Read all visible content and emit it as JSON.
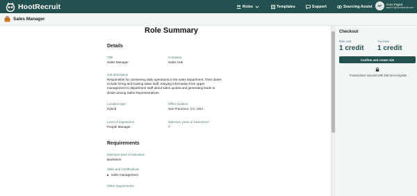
{
  "app": {
    "brand": "HootRecruit"
  },
  "nav": {
    "roles": "Roles",
    "templates": "Templates",
    "support": "Support",
    "sourcing": "Sourcing Assist"
  },
  "user": {
    "initials": "AP",
    "name": "Anne Paged",
    "email": "anne+1@hootrecruit.com"
  },
  "subheader": {
    "title": "Sales Manager"
  },
  "summary": {
    "heading": "Role Summary",
    "details": {
      "heading": "Details",
      "title_label": "Title",
      "title_value": "Sales Manager",
      "company_label": "Company",
      "company_value": "Sales Hub",
      "job_desc_label": "Job description",
      "job_desc_lines": [
        "Responsible for overseeing daily operations in the sales department. Their duties",
        "include hiring and training sales staff, relaying information from upper",
        "management to department staff about sales quotas and generating leads to",
        "divide among Sales Representatives."
      ],
      "location_type_label": "Location type",
      "location_type_value": "Hybrid",
      "office_location_label": "Office location",
      "office_location_value": "San Francisco, CA, USA",
      "level_label": "Level of experience",
      "level_value": "People Manager",
      "min_years_label": "Minimum years of experience",
      "min_years_value": "7"
    },
    "requirements": {
      "heading": "Requirements",
      "education_label": "Minimum level of education",
      "education_value": "Bachelors",
      "skills_label": "Skills and Certifications",
      "skills": [
        "sales management"
      ],
      "other_label": "Other requirements"
    }
  },
  "checkout": {
    "title": "Checkout",
    "role_cost_label": "Role cost",
    "role_cost_value": "1 credit",
    "you_have_label": "You have",
    "you_have_value": "1 credit",
    "confirm_label": "Confirm and create role",
    "secure_text": "Transactions secured with 256 bit encryption"
  },
  "colors": {
    "brand": "#23514f",
    "label": "#4a7b73"
  }
}
